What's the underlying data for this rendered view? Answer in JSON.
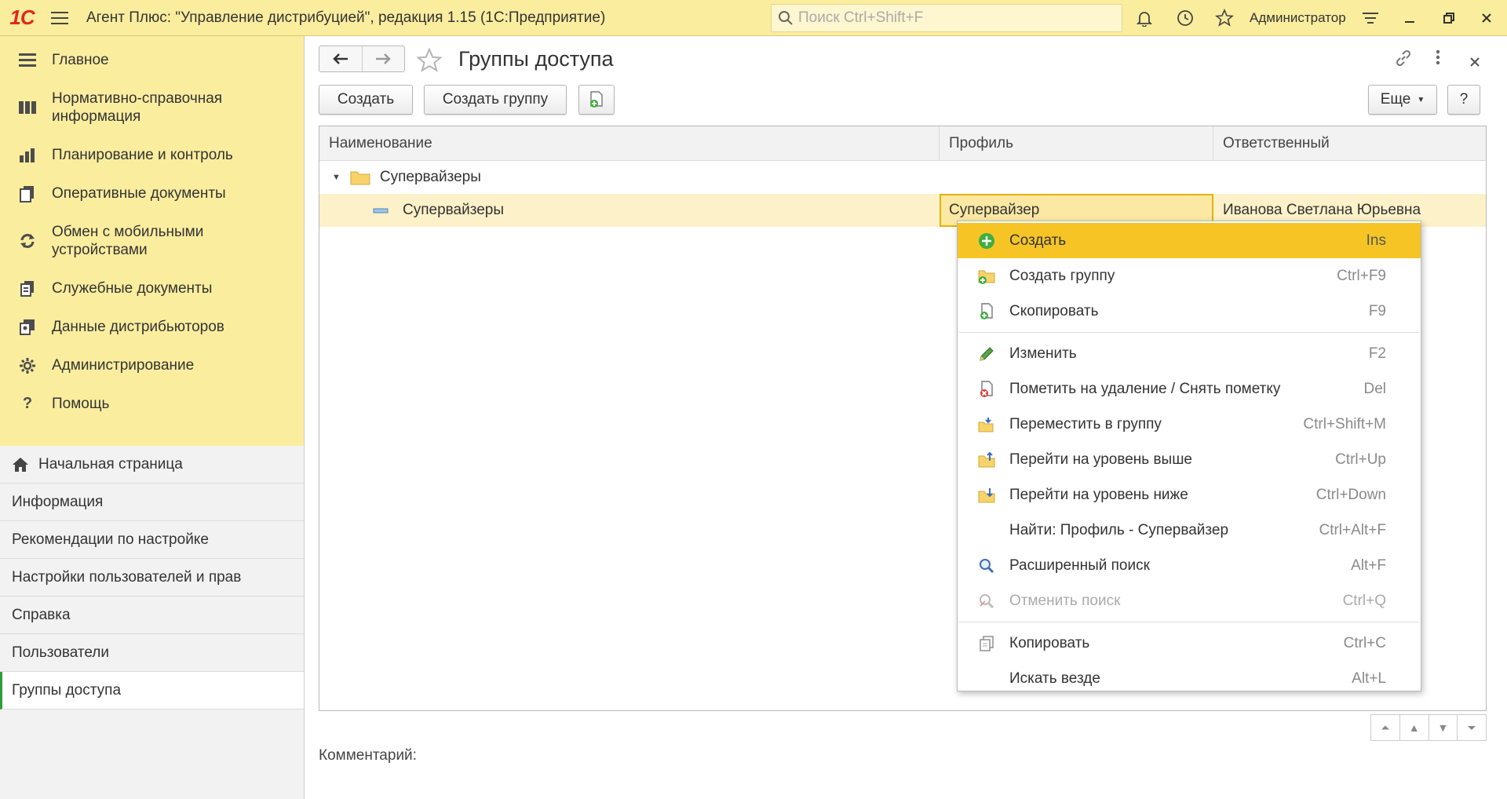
{
  "titlebar": {
    "logo": "1С",
    "title": "Агент Плюс: \"Управление дистрибуцией\", редакция 1.15  (1С:Предприятие)",
    "search_placeholder": "Поиск Ctrl+Shift+F",
    "user": "Администратор"
  },
  "sidebar": {
    "sections": [
      {
        "label": "Главное",
        "icon": "menu-lines-icon"
      },
      {
        "label": "Нормативно-справочная информация",
        "icon": "catalog-icon"
      },
      {
        "label": "Планирование и контроль",
        "icon": "chart-icon"
      },
      {
        "label": "Оперативные документы",
        "icon": "documents-icon"
      },
      {
        "label": "Обмен с мобильными устройствами",
        "icon": "sync-icon"
      },
      {
        "label": "Служебные документы",
        "icon": "service-docs-icon"
      },
      {
        "label": "Данные дистрибьюторов",
        "icon": "distributors-icon"
      },
      {
        "label": "Администрирование",
        "icon": "gear-icon"
      },
      {
        "label": "Помощь",
        "icon": "help-icon"
      }
    ],
    "open_windows": [
      {
        "label": "Начальная страница"
      },
      {
        "label": "Информация"
      },
      {
        "label": "Рекомендации по настройке"
      },
      {
        "label": "Настройки пользователей и прав"
      },
      {
        "label": "Справка"
      },
      {
        "label": "Пользователи"
      },
      {
        "label": "Группы доступа"
      }
    ]
  },
  "form": {
    "title": "Группы доступа",
    "create_label": "Создать",
    "create_group_label": "Создать группу",
    "more_label": "Еще",
    "help_label": "?",
    "comment_label": "Комментарий:"
  },
  "table": {
    "columns": [
      "Наименование",
      "Профиль",
      "Ответственный"
    ],
    "rows": [
      {
        "name": "Супервайзеры",
        "profile": "",
        "responsible": "",
        "type": "group"
      },
      {
        "name": "Супервайзеры",
        "profile": "Супервайзер",
        "responsible": "Иванова Светлана Юрьевна",
        "type": "item"
      }
    ]
  },
  "context_menu": {
    "items": [
      {
        "label": "Создать",
        "shortcut": "Ins",
        "icon": "plus-circle-icon"
      },
      {
        "label": "Создать группу",
        "shortcut": "Ctrl+F9",
        "icon": "folder-add-icon"
      },
      {
        "label": "Скопировать",
        "shortcut": "F9",
        "icon": "copy-add-icon"
      },
      {
        "label": "Изменить",
        "shortcut": "F2",
        "icon": "pencil-icon"
      },
      {
        "label": "Пометить на удаление / Снять пометку",
        "shortcut": "Del",
        "icon": "delete-mark-icon"
      },
      {
        "label": "Переместить в группу",
        "shortcut": "Ctrl+Shift+M",
        "icon": "move-to-group-icon"
      },
      {
        "label": "Перейти на уровень выше",
        "shortcut": "Ctrl+Up",
        "icon": "level-up-icon"
      },
      {
        "label": "Перейти на уровень ниже",
        "shortcut": "Ctrl+Down",
        "icon": "level-down-icon"
      },
      {
        "label": "Найти: Профиль - Супервайзер",
        "shortcut": "Ctrl+Alt+F",
        "icon": ""
      },
      {
        "label": "Расширенный поиск",
        "shortcut": "Alt+F",
        "icon": "search-advanced-icon"
      },
      {
        "label": "Отменить поиск",
        "shortcut": "Ctrl+Q",
        "icon": "search-cancel-icon"
      },
      {
        "label": "Копировать",
        "shortcut": "Ctrl+C",
        "icon": "copy-icon"
      },
      {
        "label": "Искать везде",
        "shortcut": "Alt+L",
        "icon": ""
      }
    ]
  },
  "colors": {
    "titlebar": "#fbed9e",
    "highlight": "#f6c525",
    "selected_row": "#fcf1c8",
    "active_marker": "#2e9e3a"
  }
}
